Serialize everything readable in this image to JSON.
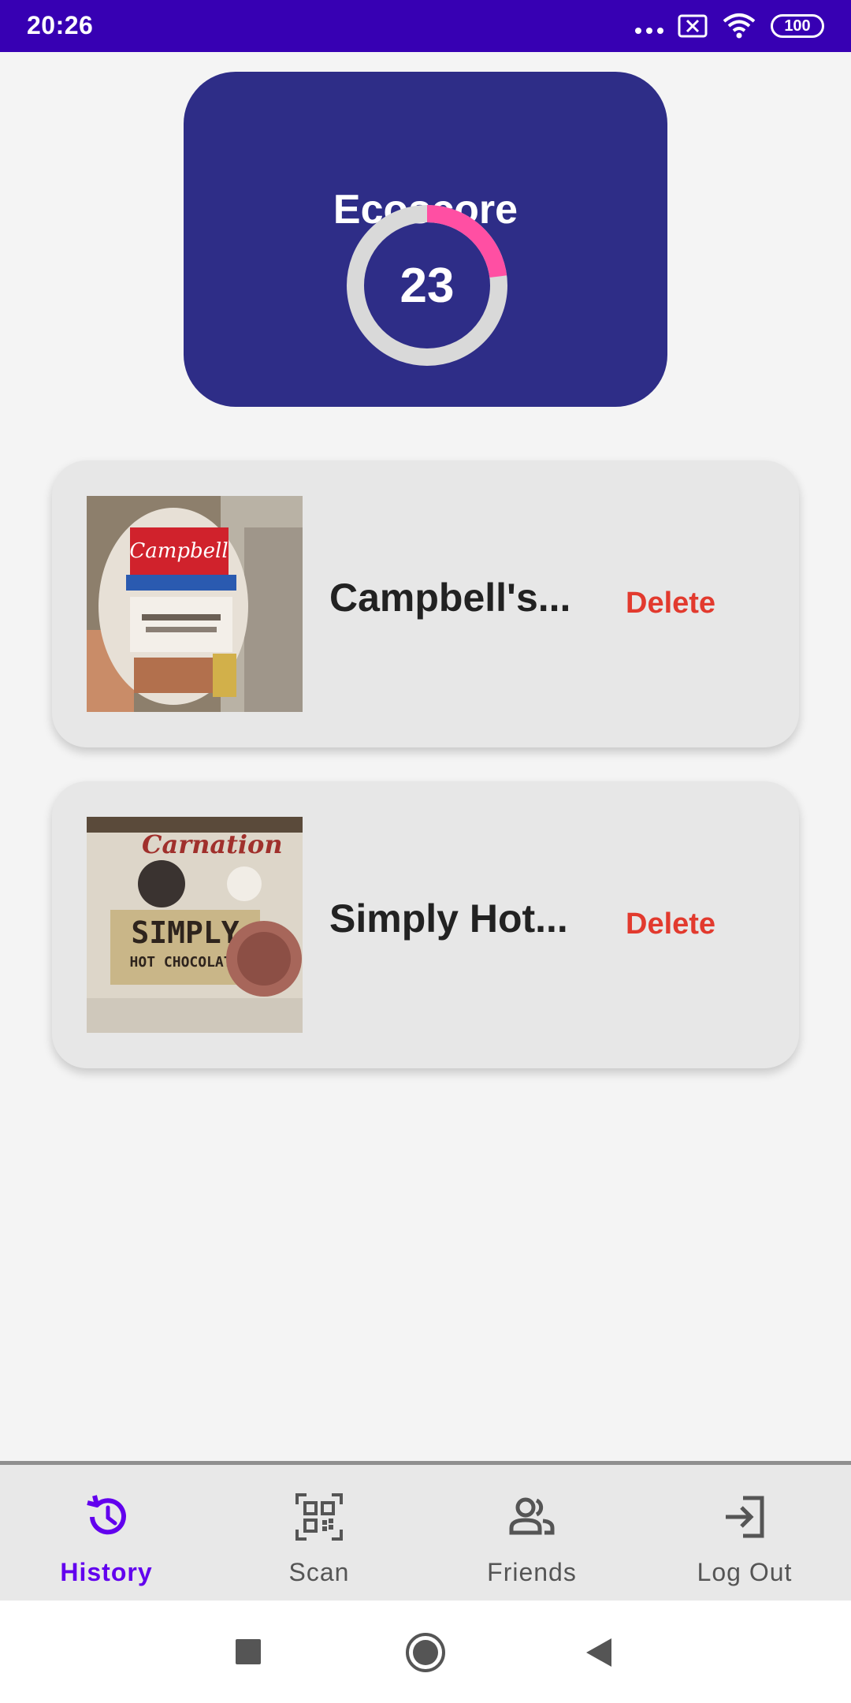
{
  "status_bar": {
    "time": "20:26",
    "battery": "100",
    "icons": [
      "more-dots-icon",
      "notification-x-icon",
      "wifi-icon",
      "battery-icon"
    ]
  },
  "ecoscore": {
    "title": "Ecoscore",
    "value": "23",
    "progress_percent": 23,
    "colors": {
      "card": "#2e2d87",
      "ring_track": "#d9d9d9",
      "ring_fill": "#ff4fa3"
    }
  },
  "history": {
    "items": [
      {
        "name": "Campbell's...",
        "delete_label": "Delete",
        "image": "campbells-soup-can-photo"
      },
      {
        "name": "Simply Hot...",
        "delete_label": "Delete",
        "image": "carnation-hot-chocolate-photo"
      }
    ]
  },
  "bottom_nav": {
    "items": [
      {
        "label": "History",
        "icon": "history-icon",
        "active": true
      },
      {
        "label": "Scan",
        "icon": "qr-scan-icon",
        "active": false
      },
      {
        "label": "Friends",
        "icon": "friends-icon",
        "active": false
      },
      {
        "label": "Log Out",
        "icon": "logout-icon",
        "active": false
      }
    ],
    "active_color": "#6200ee"
  },
  "system_nav": {
    "buttons": [
      "recents-square-icon",
      "home-circle-icon",
      "back-triangle-icon"
    ]
  }
}
